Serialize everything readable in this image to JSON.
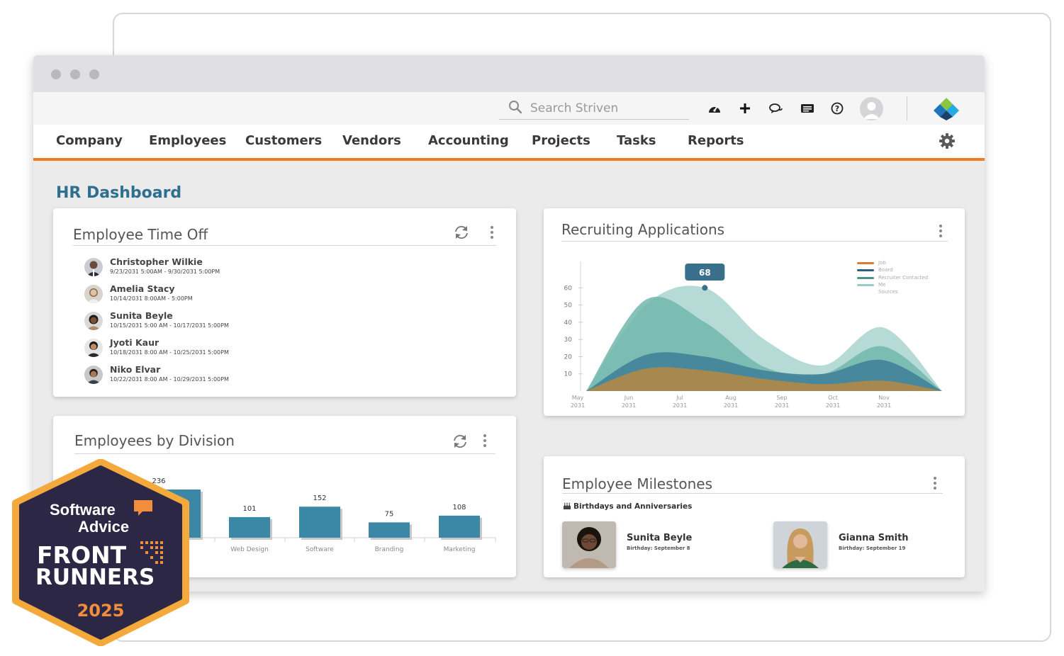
{
  "search": {
    "placeholder": "Search Striven"
  },
  "toolbar_icons": [
    "dashboard-icon",
    "plus-icon",
    "chat-icon",
    "messages-icon",
    "help-icon"
  ],
  "nav": {
    "items": [
      "Company",
      "Employees",
      "Customers",
      "Vendors",
      "Accounting",
      "Projects",
      "Tasks",
      "Reports"
    ]
  },
  "page": {
    "title": "HR Dashboard"
  },
  "time_off": {
    "title": "Employee Time Off",
    "entries": [
      {
        "name": "Christopher Wilkie",
        "dates": "9/23/2031 5:00AM - 9/30/2031 5:00PM"
      },
      {
        "name": "Amelia Stacy",
        "dates": "10/14/2031 8:00AM - 5:00PM"
      },
      {
        "name": "Sunita Beyle",
        "dates": "10/15/2031 5:00 AM - 10/17/2031 5:00PM"
      },
      {
        "name": "Jyoti Kaur",
        "dates": "10/18/2031 8:00 AM - 10/25/2031 5:00PM"
      },
      {
        "name": "Niko Elvar",
        "dates": "10/22/2031 8:00 AM - 10/29/2031 5:00PM"
      }
    ]
  },
  "recruiting": {
    "title": "Recruiting Applications",
    "legend": [
      "Job",
      "Board",
      "Recruiter Contacted",
      "Me",
      "Sources"
    ]
  },
  "division": {
    "title": "Employees by Division"
  },
  "milestones": {
    "title": "Employee Milestones",
    "subtitle": "Birthdays and Anniversaries",
    "people": [
      {
        "name": "Sunita Beyle",
        "detail": "Birthday: September 8"
      },
      {
        "name": "Gianna Smith",
        "detail": "Birthday: September 19"
      }
    ]
  },
  "badge": {
    "line1": "Software",
    "line2": "Advice",
    "line3": "FRONT",
    "line4": "RUNNERS",
    "year": "2025"
  },
  "colors": {
    "accent": "#f07c22",
    "title_blue": "#2e6f90",
    "bar_blue": "#3a87a6",
    "badge_navy": "#2b2745"
  },
  "chart_data": [
    {
      "type": "area",
      "x": [
        "May 2031",
        "Jun 2031",
        "Jul 2031",
        "Aug 2031",
        "Sep 2031",
        "Oct 2031",
        "Nov 2031"
      ],
      "ylim": [
        0,
        70
      ],
      "yticks": [
        10,
        20,
        30,
        40,
        50,
        60
      ],
      "highlight": {
        "label": "68",
        "x": "Jul 2031",
        "value": 60
      },
      "series": [
        {
          "name": "Job",
          "color": "#b98a43",
          "values": [
            0,
            13,
            12,
            7,
            4,
            6,
            0
          ]
        },
        {
          "name": "Board",
          "color": "#3f7f98",
          "values": [
            0,
            21,
            20,
            12,
            10,
            18,
            0
          ]
        },
        {
          "name": "Recruiter Contacted",
          "color": "#72b7ad",
          "values": [
            0,
            53,
            40,
            14,
            10,
            26,
            0
          ]
        },
        {
          "name": "Me",
          "color": "#a9d4cf",
          "values": [
            0,
            50,
            60,
            30,
            15,
            37,
            0
          ]
        }
      ]
    },
    {
      "type": "bar",
      "categories": [
        "",
        "Web Design",
        "Software",
        "Branding",
        "Marketing"
      ],
      "values": [
        236,
        101,
        152,
        75,
        108
      ],
      "ylim": [
        0,
        260
      ]
    }
  ]
}
